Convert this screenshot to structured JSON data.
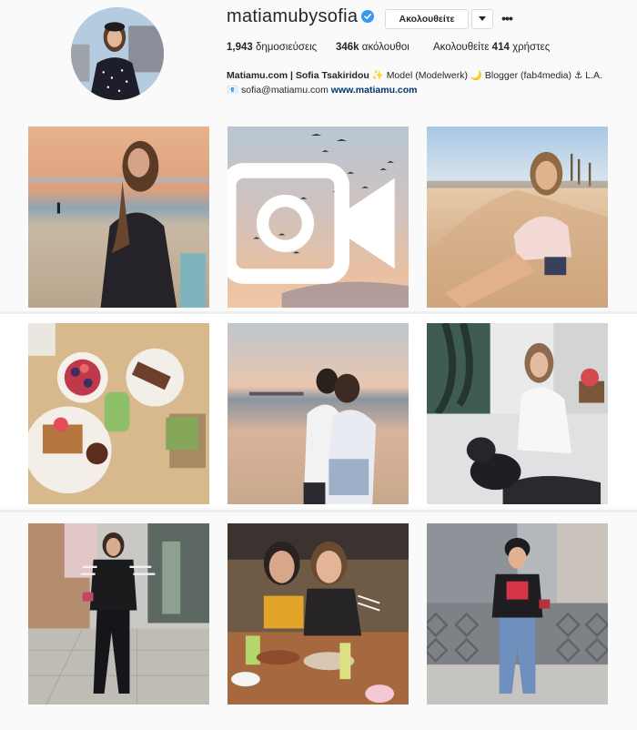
{
  "profile": {
    "username": "matiamubysofia",
    "verified": true,
    "follow_label": "Ακολουθείτε",
    "posts_count": "1,943",
    "posts_label": "δημοσιεύσεις",
    "followers_count": "346k",
    "followers_label": "ακόλουθοι",
    "following_prefix": "Ακολουθείτε",
    "following_count": "414",
    "following_label": "χρήστες",
    "bio_name": "Matiamu.com | Sofia Tsakiridou",
    "bio_line1_rest": " ✨ Model (Modelwerk) 🌙 Blogger (fab4media) ⚓ L.A.",
    "bio_email": "📧 sofia@matiamu.com",
    "bio_link": "www.matiamu.com"
  },
  "posts": [
    {
      "icon": "photo",
      "desc": "woman on beach at sunset"
    },
    {
      "icon": "video-camera-icon",
      "desc": "birds over sunset sky"
    },
    {
      "icon": "photo",
      "desc": "woman sitting on sand"
    },
    {
      "icon": "photo",
      "desc": "breakfast table"
    },
    {
      "icon": "photo",
      "desc": "couple hugging on beach"
    },
    {
      "icon": "photo",
      "desc": "woman with dog on couch"
    },
    {
      "icon": "photo",
      "desc": "woman on street"
    },
    {
      "icon": "photo",
      "desc": "two women at cafe"
    },
    {
      "icon": "photo",
      "desc": "woman on bridge"
    }
  ],
  "colors": {
    "accent": "#3897f0",
    "link": "#003569",
    "text": "#262626",
    "border": "#dbdbdb"
  }
}
